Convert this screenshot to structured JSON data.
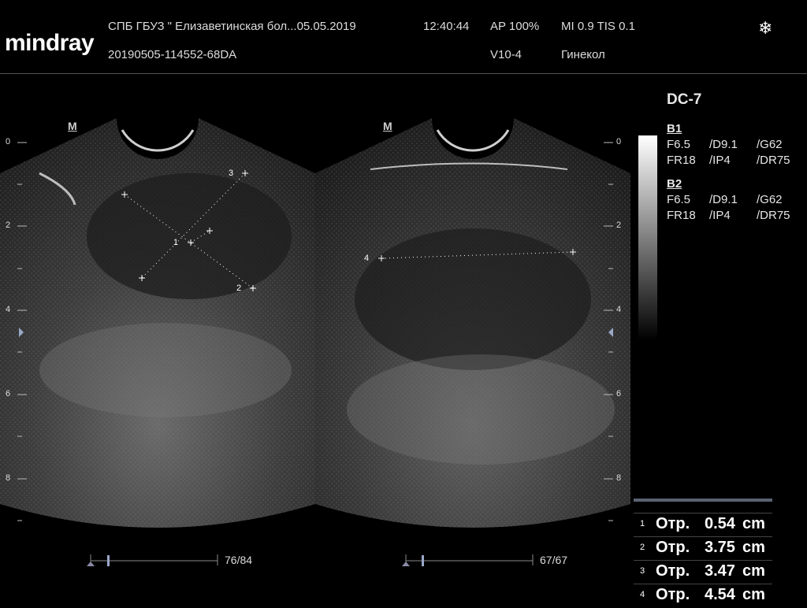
{
  "header": {
    "brand": "mindray",
    "facility": "СПБ  ГБУЗ \" Елизаветинская бол...05.05.2019",
    "time": "12:40:44",
    "ap": "AP  100%",
    "mi_tis": "MI 0.9 TIS 0.1",
    "study_id": "20190505-114552-68DA",
    "probe": "V10-4",
    "preset": "Гинекол",
    "freeze_icon": "snowflake-icon"
  },
  "panes": [
    {
      "marker": "M",
      "frame": "76/84"
    },
    {
      "marker": "M",
      "frame": "67/67"
    }
  ],
  "depth_ticks": [
    "0",
    "2",
    "4",
    "6",
    "8"
  ],
  "params": {
    "title": "DC-7",
    "b1": {
      "label": "B1",
      "f": "F6.5",
      "d": "/D9.1",
      "g": "/G62",
      "fr": "FR18",
      "ip": "/IP4",
      "dr": "/DR75"
    },
    "b2": {
      "label": "B2",
      "f": "F6.5",
      "d": "/D9.1",
      "g": "/G62",
      "fr": "FR18",
      "ip": "/IP4",
      "dr": "/DR75"
    }
  },
  "calipers": [
    "1",
    "2",
    "3",
    "4"
  ],
  "measurements": [
    {
      "idx": "1",
      "label": "Отр.",
      "value": "0.54",
      "unit": "cm"
    },
    {
      "idx": "2",
      "label": "Отр.",
      "value": "3.75",
      "unit": "cm"
    },
    {
      "idx": "3",
      "label": "Отр.",
      "value": "3.47",
      "unit": "cm"
    },
    {
      "idx": "4",
      "label": "Отр.",
      "value": "4.54",
      "unit": "cm"
    }
  ],
  "colors": {
    "background": "#000000",
    "text": "#e6e6e6",
    "caliper": "#ffffff",
    "ruler": "#8a8aa8"
  }
}
